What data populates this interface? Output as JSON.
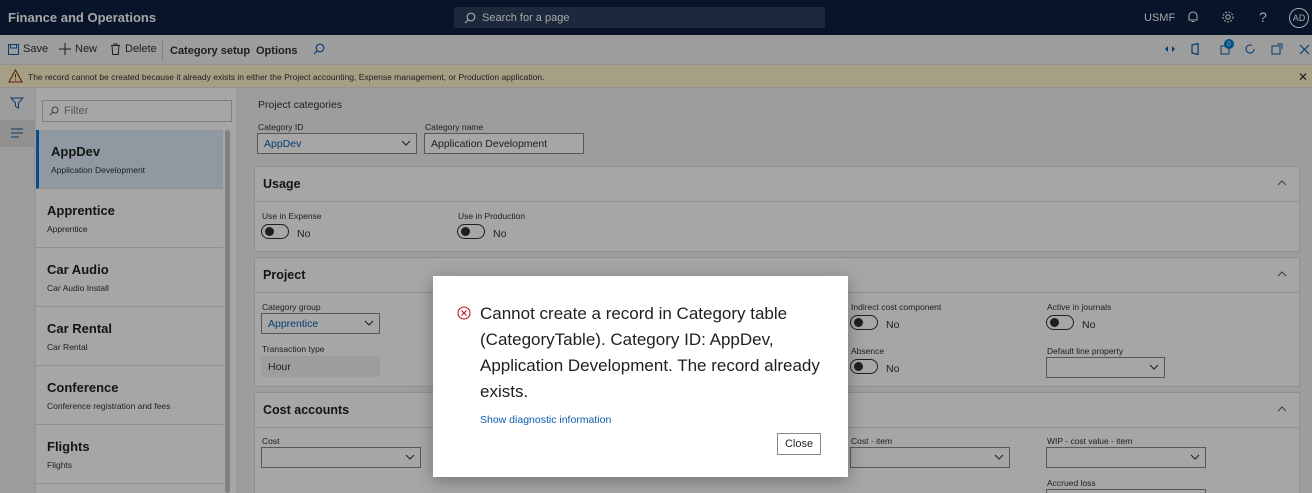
{
  "topbar": {
    "app_title": "Finance and Operations",
    "search_placeholder": "Search for a page",
    "company": "USMF",
    "avatar_initials": "AD"
  },
  "actionbar": {
    "save": "Save",
    "new": "New",
    "delete": "Delete",
    "category_setup": "Category setup",
    "options": "Options",
    "attachments_count": "0"
  },
  "warning": {
    "text": "The record cannot be created because it already exists in either the Project accounting, Expense management, or Production application."
  },
  "list": {
    "filter_placeholder": "Filter",
    "items": [
      {
        "title": "AppDev",
        "subtitle": "Application Development"
      },
      {
        "title": "Apprentice",
        "subtitle": "Apprentice"
      },
      {
        "title": "Car Audio",
        "subtitle": "Car Audio Install"
      },
      {
        "title": "Car Rental",
        "subtitle": "Car Rental"
      },
      {
        "title": "Conference",
        "subtitle": "Conference registration and fees"
      },
      {
        "title": "Flights",
        "subtitle": "Flights"
      }
    ]
  },
  "form": {
    "caption": "Project categories",
    "category_id_label": "Category ID",
    "category_id_value": "AppDev",
    "category_name_label": "Category name",
    "category_name_value": "Application Development"
  },
  "usage": {
    "title": "Usage",
    "use_in_expense_label": "Use in Expense",
    "use_in_expense_value": "No",
    "use_in_production_label": "Use in Production",
    "use_in_production_value": "No"
  },
  "project": {
    "title": "Project",
    "category_group_label": "Category group",
    "category_group_value": "Apprentice",
    "transaction_type_label": "Transaction type",
    "transaction_type_value": "Hour",
    "indirect_cost_label": "Indirect cost component",
    "indirect_cost_value": "No",
    "active_journals_label": "Active in journals",
    "active_journals_value": "No",
    "absence_label": "Absence",
    "absence_value": "No",
    "default_line_label": "Default line property"
  },
  "cost_accounts": {
    "title": "Cost accounts",
    "cost_label": "Cost",
    "cost_item_label": "Cost - item",
    "wip_label": "WIP - cost value - item",
    "accrued_loss_label": "Accrued loss"
  },
  "dialog": {
    "message": "Cannot create a record in Category table (CategoryTable). Category ID: AppDev, Application Development. The record already exists.",
    "link": "Show diagnostic information",
    "close": "Close"
  }
}
